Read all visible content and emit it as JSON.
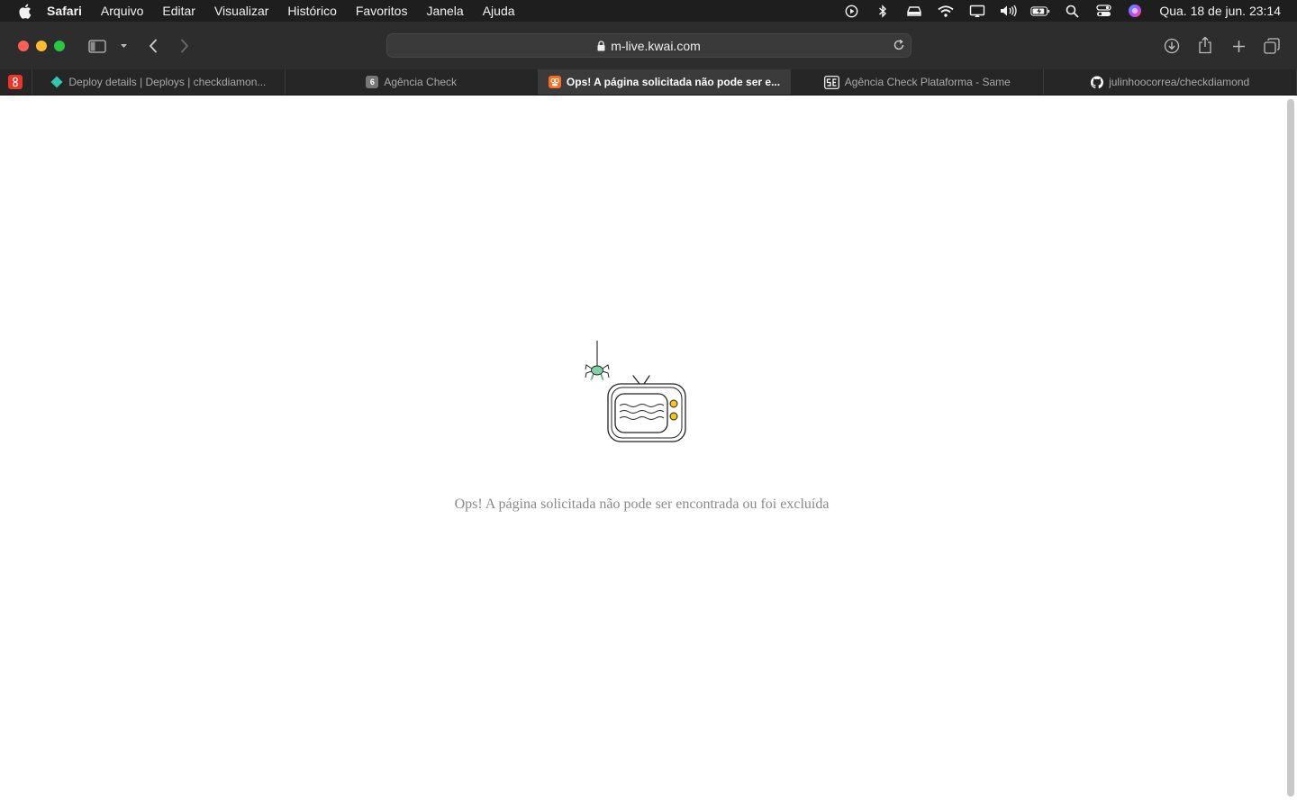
{
  "menubar": {
    "app_name": "Safari",
    "items": [
      "Arquivo",
      "Editar",
      "Visualizar",
      "Histórico",
      "Favoritos",
      "Janela",
      "Ajuda"
    ],
    "clock": "Qua. 18 de jun.  23:14",
    "status_icons": [
      "play-circle-icon",
      "bluetooth-icon",
      "car-icon",
      "wifi-icon",
      "display-icon",
      "volume-icon",
      "battery-icon",
      "spotlight-icon",
      "control-center-icon",
      "siri-icon"
    ]
  },
  "toolbar": {
    "url": "m-live.kwai.com"
  },
  "tabs": [
    {
      "label": "Deploy details | Deploys | checkdiamon...",
      "favicon": "netlify-icon",
      "color": "#30c8b4",
      "active": false
    },
    {
      "label": "Agência Check",
      "favicon": "letter-6-icon",
      "favicon_text": "6",
      "color": "#777777",
      "active": false
    },
    {
      "label": "Ops! A página solicitada não pode ser e...",
      "favicon": "kwai-icon",
      "color": "#ff6a1f",
      "active": true
    },
    {
      "label": "Agência Check Plataforma - Same",
      "favicon": "same-icon",
      "color": "#ffffff",
      "active": false
    },
    {
      "label": "julinhoocorrea/checkdiamond",
      "favicon": "github-icon",
      "color": "#ffffff",
      "active": false
    }
  ],
  "page": {
    "message": "Ops! A página solicitada não pode ser encontrada ou foi excluída"
  },
  "colors": {
    "menubar_bg": "#1e1e1e",
    "toolbar_bg": "#2d2d2d",
    "text_gray": "#8a8a8a",
    "spider_green": "#7fd1a8",
    "tv_knob": "#f5c518"
  }
}
